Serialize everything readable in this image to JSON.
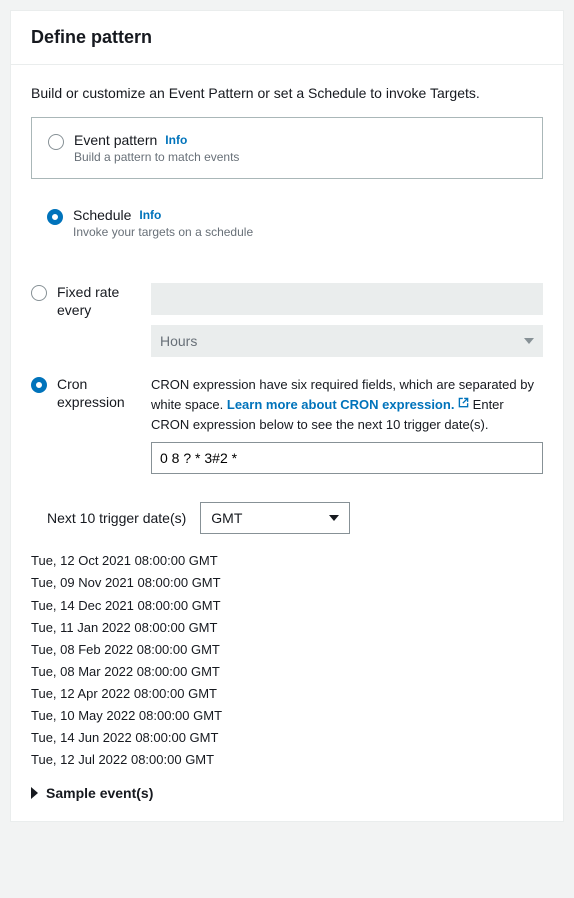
{
  "header": {
    "title": "Define pattern"
  },
  "intro": "Build or customize an Event Pattern or set a Schedule to invoke Targets.",
  "options": {
    "event_pattern": {
      "label": "Event pattern",
      "info": "Info",
      "desc": "Build a pattern to match events",
      "selected": false
    },
    "schedule": {
      "label": "Schedule",
      "info": "Info",
      "desc": "Invoke your targets on a schedule",
      "selected": true
    }
  },
  "rate_options": {
    "fixed_rate": {
      "label": "Fixed rate every",
      "value": "",
      "unit": "Hours",
      "selected": false
    },
    "cron": {
      "label": "Cron expression",
      "help_pre": "CRON expression have six required fields, which are separated by white space. ",
      "link": "Learn more about CRON expression.",
      "help_post": " Enter CRON expression below to see the next 10 trigger date(s).",
      "value": "0 8 ? * 3#2 *",
      "selected": true
    }
  },
  "triggers": {
    "label": "Next 10 trigger date(s)",
    "timezone": "GMT",
    "dates": [
      "Tue, 12 Oct 2021 08:00:00 GMT",
      "Tue, 09 Nov 2021 08:00:00 GMT",
      "Tue, 14 Dec 2021 08:00:00 GMT",
      "Tue, 11 Jan 2022 08:00:00 GMT",
      "Tue, 08 Feb 2022 08:00:00 GMT",
      "Tue, 08 Mar 2022 08:00:00 GMT",
      "Tue, 12 Apr 2022 08:00:00 GMT",
      "Tue, 10 May 2022 08:00:00 GMT",
      "Tue, 14 Jun 2022 08:00:00 GMT",
      "Tue, 12 Jul 2022 08:00:00 GMT"
    ]
  },
  "sample_events": {
    "label": "Sample event(s)"
  }
}
